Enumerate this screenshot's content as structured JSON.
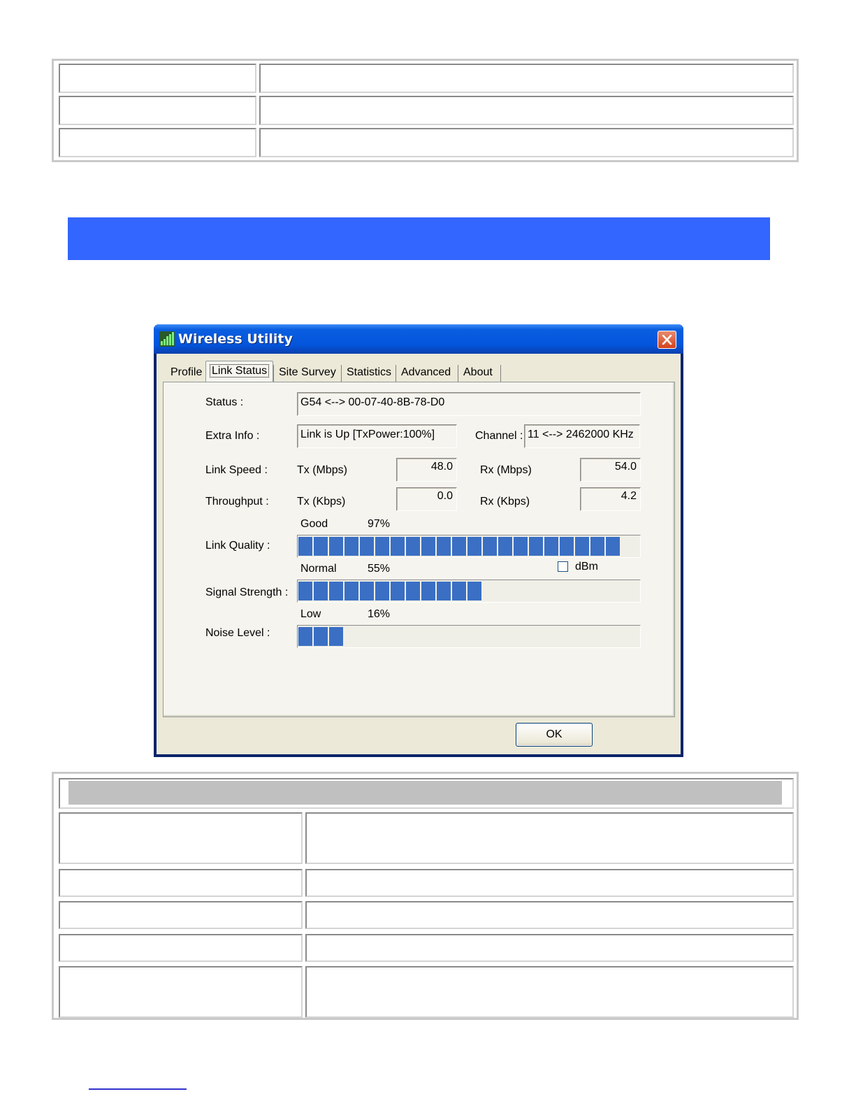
{
  "window": {
    "title": "Wireless Utility",
    "close_icon": "close-icon",
    "app_icon": "signal-bars-icon"
  },
  "tabs": [
    {
      "label": "Profile"
    },
    {
      "label": "Link Status",
      "active": true
    },
    {
      "label": "Site Survey"
    },
    {
      "label": "Statistics"
    },
    {
      "label": "Advanced"
    },
    {
      "label": "About"
    }
  ],
  "link_status": {
    "status_label": "Status :",
    "status_value": "G54 <--> 00-07-40-8B-78-D0",
    "extra_info_label": "Extra Info :",
    "extra_info_value": "Link is Up [TxPower:100%]",
    "channel_label": "Channel :",
    "channel_value": "11 <--> 2462000 KHz",
    "link_speed_label": "Link Speed :",
    "tx_mbps_label": "Tx (Mbps)",
    "tx_mbps_value": "48.0",
    "rx_mbps_label": "Rx (Mbps)",
    "rx_mbps_value": "54.0",
    "throughput_label": "Throughput :",
    "tx_kbps_label": "Tx (Kbps)",
    "tx_kbps_value": "0.0",
    "rx_kbps_label": "Rx (Kbps)",
    "rx_kbps_value": "4.2",
    "link_quality_label": "Link Quality :",
    "link_quality_text": "Good",
    "link_quality_percent": "97%",
    "link_quality_level": 0.97,
    "signal_strength_label": "Signal Strength :",
    "signal_strength_text": "Normal",
    "signal_strength_percent": "55%",
    "signal_strength_level": 0.55,
    "dbm_label": "dBm",
    "dbm_checked": false,
    "noise_level_label": "Noise Level :",
    "noise_level_text": "Low",
    "noise_level_percent": "16%",
    "noise_level_level": 0.16,
    "bar_color": "#3a6fc4"
  },
  "ok_button": "OK",
  "colors": {
    "header_bar": "#3366ff",
    "title_bar": "#0355db",
    "banner": "#c0c0c0"
  }
}
